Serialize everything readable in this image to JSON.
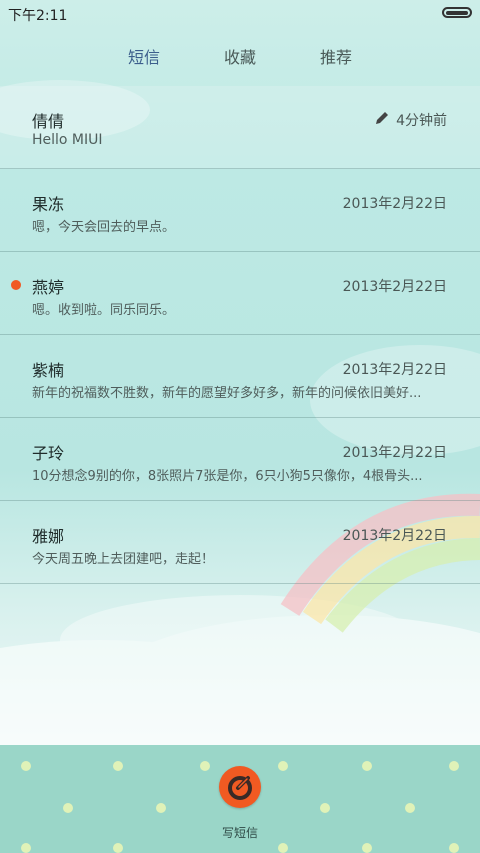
{
  "status_bar": {
    "time": "下午2:11"
  },
  "tabs": [
    {
      "label": "短信",
      "active": true
    },
    {
      "label": "收藏",
      "active": false
    },
    {
      "label": "推荐",
      "active": false
    }
  ],
  "messages": [
    {
      "name": "倩倩",
      "time": "4分钟前",
      "preview": "Hello MIUI",
      "draft_icon": "pencil-icon"
    },
    {
      "name": "果冻",
      "time": "2013年2月22日",
      "preview": "嗯，今天会回去的早点。"
    },
    {
      "name": "燕婷",
      "time": "2013年2月22日",
      "preview": "嗯。收到啦。同乐同乐。",
      "unread": true
    },
    {
      "name": "紫楠",
      "time": "2013年2月22日",
      "preview": "新年的祝福数不胜数，新年的愿望好多好多，新年的问候依旧美好..."
    },
    {
      "name": "子玲",
      "time": "2013年2月22日",
      "preview": "10分想念9别的你，8张照片7张是你，6只小狗5只像你，4根骨头..."
    },
    {
      "name": "雅娜",
      "time": "2013年2月22日",
      "preview": "今天周五晚上去团建吧，走起！"
    }
  ],
  "compose": {
    "label": "写短信",
    "icon": "compose-icon"
  },
  "colors": {
    "accent": "#f15a22",
    "active_tab": "#3c5e8c",
    "bottom_bar": "#9ad6c8"
  }
}
